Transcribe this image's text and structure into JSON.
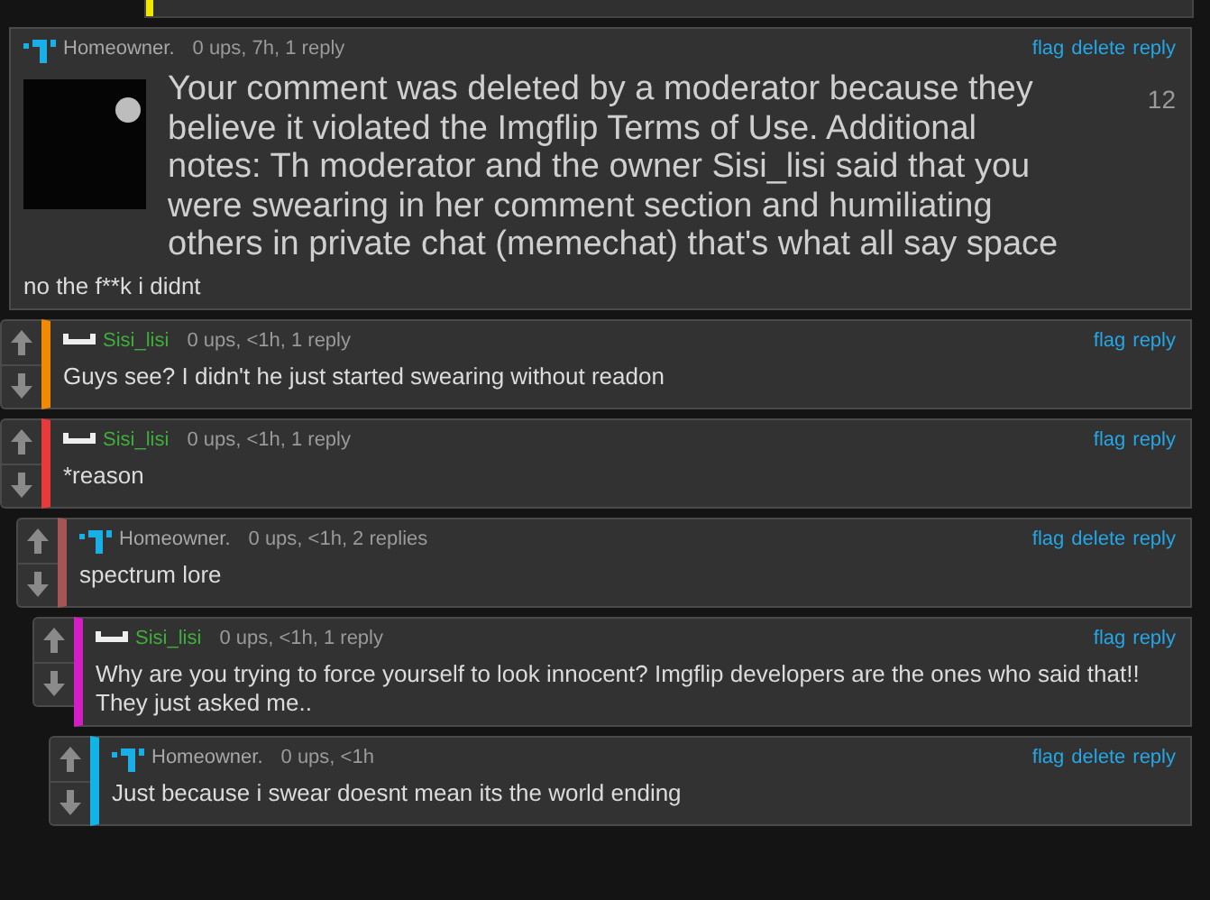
{
  "cut_comment": {
    "color": "#f2e600"
  },
  "comments": [
    {
      "kind": "meme",
      "author": {
        "name": "Homeowner.",
        "kind": "figure"
      },
      "meta": "0 ups, 7h, 1 reply",
      "actions": [
        "flag",
        "delete",
        "reply"
      ],
      "meme": {
        "caption": "Your comment was deleted by a moderator because they believe it violated the Imgflip Terms of Use. Additional notes: Th moderator and the owner Sisi_lisi said that you were swearing in her comment section and humiliating others in private chat (memechat) that's what all say space",
        "number": "12"
      },
      "text": "no the f**k i didnt"
    },
    {
      "kind": "text",
      "author": {
        "name": "Sisi_lisi",
        "kind": "bar"
      },
      "color": "#f28a00",
      "meta": "0 ups, <1h, 1 reply",
      "actions": [
        "flag",
        "reply"
      ],
      "text": "Guys see? I didn't he just started swearing without readon"
    },
    {
      "kind": "text",
      "author": {
        "name": "Sisi_lisi",
        "kind": "bar"
      },
      "color": "#e83a3a",
      "meta": "0 ups, <1h, 1 reply",
      "actions": [
        "flag",
        "reply"
      ],
      "text": "*reason",
      "children": [
        {
          "kind": "text",
          "author": {
            "name": "Homeowner.",
            "kind": "figure"
          },
          "color": "#a65555",
          "meta": "0 ups, <1h, 2 replies",
          "actions": [
            "flag",
            "delete",
            "reply"
          ],
          "text": "spectrum lore",
          "children": [
            {
              "kind": "text",
              "author": {
                "name": "Sisi_lisi",
                "kind": "bar"
              },
              "color": "#d21ec4",
              "meta": "0 ups, <1h, 1 reply",
              "actions": [
                "flag",
                "reply"
              ],
              "text": "Why are you trying to force yourself to look innocent? Imgflip developers are the ones who said that!! They just asked me..",
              "children": [
                {
                  "kind": "text",
                  "author": {
                    "name": "Homeowner.",
                    "kind": "figure"
                  },
                  "color": "#12b4e6",
                  "meta": "0 ups, <1h",
                  "actions": [
                    "flag",
                    "delete",
                    "reply"
                  ],
                  "text": "Just because i swear doesnt mean its the world ending"
                }
              ]
            }
          ]
        }
      ]
    }
  ]
}
